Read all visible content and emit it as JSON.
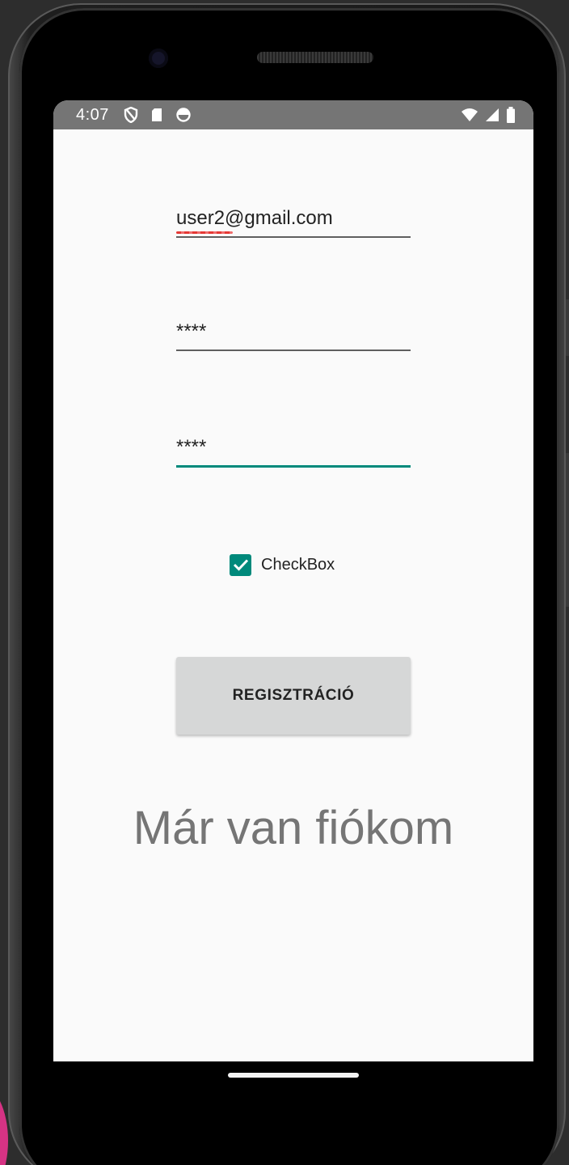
{
  "status_bar": {
    "time": "4:07",
    "icons_left": [
      "vpn-shield-icon",
      "sd-card-icon",
      "sync-icon"
    ],
    "icons_right": [
      "wifi-icon",
      "signal-icon",
      "battery-icon"
    ]
  },
  "form": {
    "email_value": "user2@gmail.com",
    "password_value": "****",
    "password_confirm_value": "****",
    "checkbox_label": "CheckBox",
    "checkbox_checked": true,
    "register_label": "REGISZTRÁCIÓ",
    "login_link": "Már van fiókom"
  },
  "colors": {
    "accent": "#00897b",
    "status_bar": "#757575",
    "button_bg": "#d6d7d7",
    "link_text": "#757575",
    "spellcheck": "#e53935"
  }
}
